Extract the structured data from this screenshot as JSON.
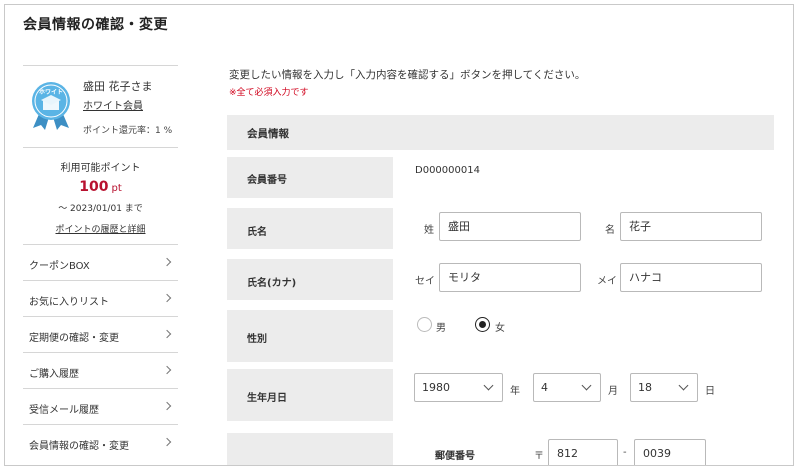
{
  "page_title": "会員情報の確認・変更",
  "member": {
    "badge_text": "ホワイト",
    "name": "盛田 花子さま",
    "rank": "ホワイト会員",
    "rate": "ポイント還元率：1 %"
  },
  "points": {
    "label": "利用可能ポイント",
    "value": "100",
    "unit": "pt",
    "expiry": "～ 2023/01/01 まで",
    "history_link": "ポイントの履歴と詳細"
  },
  "nav": [
    {
      "label": "クーポンBOX"
    },
    {
      "label": "お気に入りリスト"
    },
    {
      "label": "定期便の確認・変更"
    },
    {
      "label": "ご購入履歴"
    },
    {
      "label": "受信メール履歴"
    },
    {
      "label": "会員情報の確認・変更"
    }
  ],
  "intro": "変更したい情報を入力し「入力内容を確認する」ボタンを押してください。",
  "required_note": "※全て必須入力です",
  "section_title": "会員情報",
  "form": {
    "member_no": {
      "label": "会員番号",
      "value": "D000000014"
    },
    "name": {
      "label": "氏名",
      "sei_label": "姓",
      "sei_value": "盛田",
      "mei_label": "名",
      "mei_value": "花子"
    },
    "kana": {
      "label": "氏名(カナ)",
      "sei_label": "セイ",
      "sei_value": "モリタ",
      "mei_label": "メイ",
      "mei_value": "ハナコ"
    },
    "gender": {
      "label": "性別",
      "options": [
        "男",
        "女"
      ],
      "selected": "女"
    },
    "birth": {
      "label": "生年月日",
      "year": "1980",
      "year_unit": "年",
      "month": "4",
      "month_unit": "月",
      "day": "18",
      "day_unit": "日"
    },
    "postal": {
      "label": "郵便番号",
      "mark": "〒",
      "first": "812",
      "separator": "-",
      "second": "0039"
    }
  },
  "colors": {
    "accent": "#b8112f",
    "required": "#d0021b",
    "label_bg": "#ececec",
    "badge": "#5ab4e5"
  }
}
